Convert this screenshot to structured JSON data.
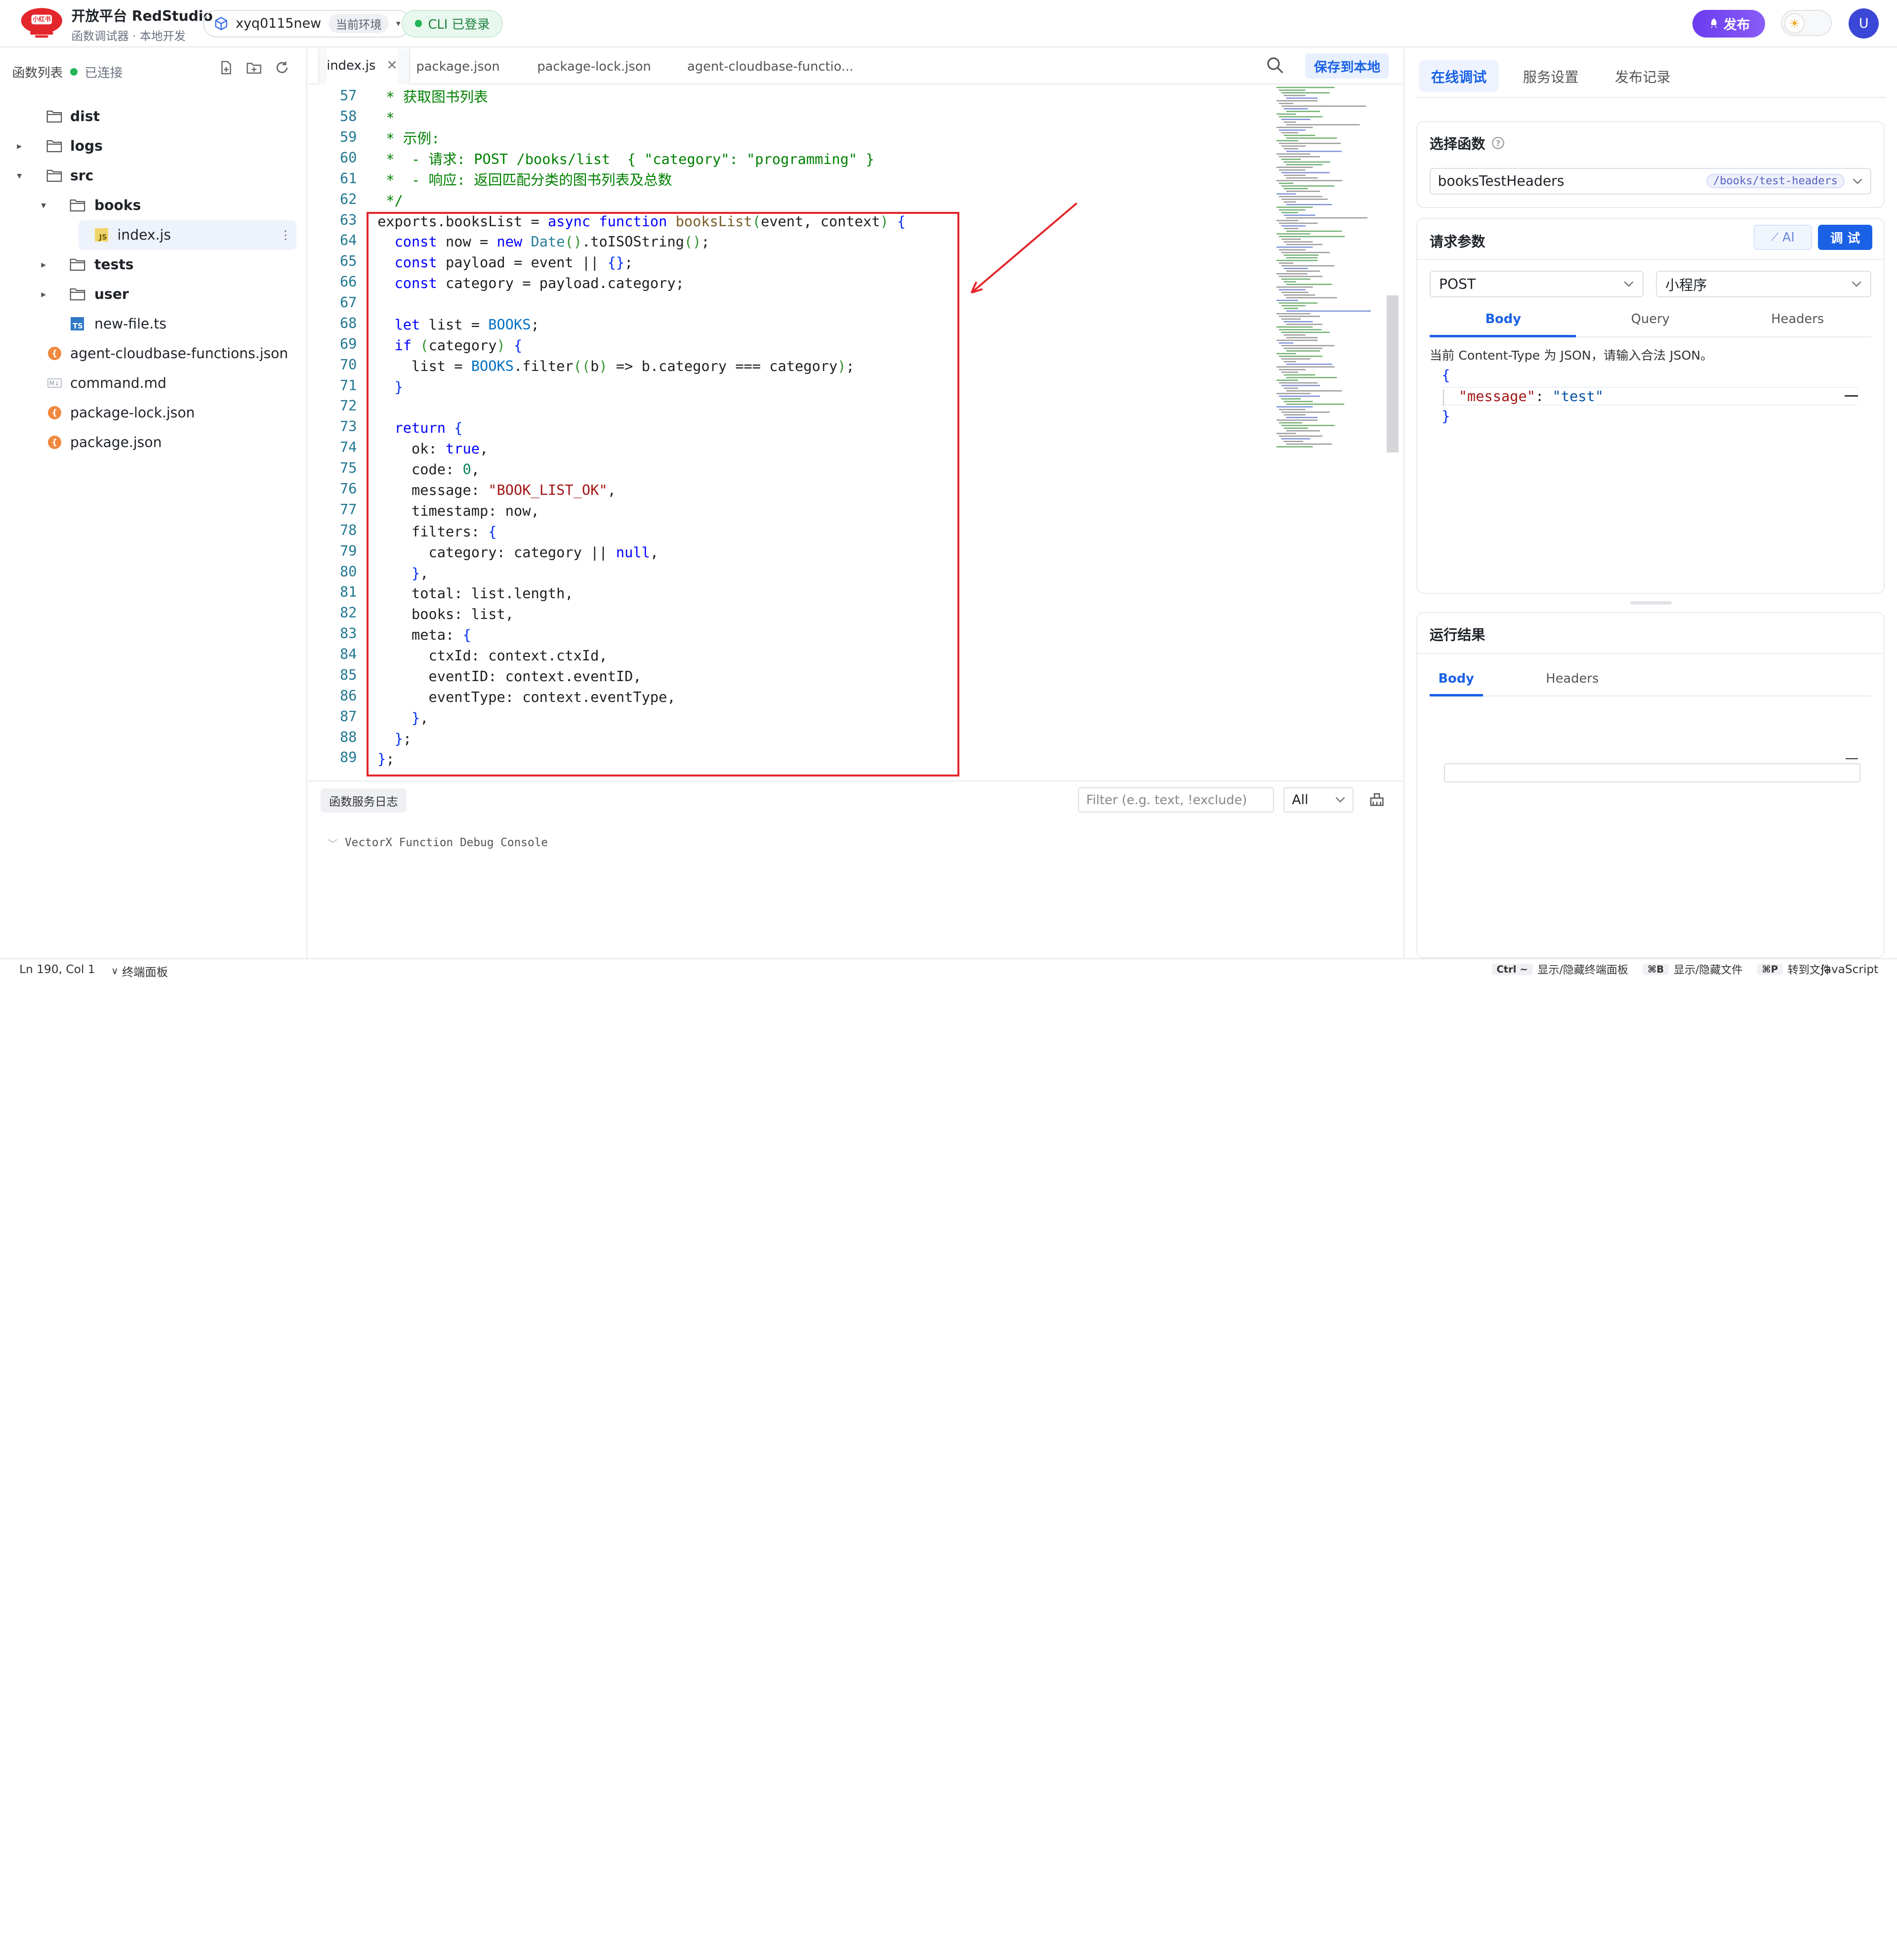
{
  "header": {
    "brand_title": "开放平台 RedStudio",
    "brand_subtitle": "函数调试器 · 本地开发",
    "logo_text": "小红书",
    "env_name": "xyq0115new",
    "env_tag": "当前环境",
    "cli_status": "CLI 已登录",
    "publish_label": "发布",
    "avatar_letter": "U"
  },
  "sidebar": {
    "title": "函数列表",
    "status": "已连接",
    "tree": [
      {
        "label": "dist",
        "type": "folder",
        "level": 1,
        "expand": "none",
        "bold": true
      },
      {
        "label": "logs",
        "type": "folder",
        "level": 1,
        "expand": "collapsed",
        "bold": true
      },
      {
        "label": "src",
        "type": "folder",
        "level": 1,
        "expand": "expanded",
        "bold": true
      },
      {
        "label": "books",
        "type": "folder",
        "level": 2,
        "expand": "expanded",
        "bold": true
      },
      {
        "label": "index.js",
        "type": "js",
        "level": 3,
        "expand": "none",
        "selected": true
      },
      {
        "label": "tests",
        "type": "folder",
        "level": 2,
        "expand": "collapsed",
        "bold": true
      },
      {
        "label": "user",
        "type": "folder",
        "level": 2,
        "expand": "collapsed",
        "bold": true
      },
      {
        "label": "new-file.ts",
        "type": "ts",
        "level": 2,
        "expand": "none"
      },
      {
        "label": "agent-cloudbase-functions.json",
        "type": "json",
        "level": 1,
        "expand": "none"
      },
      {
        "label": "command.md",
        "type": "md",
        "level": 1,
        "expand": "none"
      },
      {
        "label": "package-lock.json",
        "type": "json",
        "level": 1,
        "expand": "none"
      },
      {
        "label": "package.json",
        "type": "json",
        "level": 1,
        "expand": "none"
      }
    ]
  },
  "editor": {
    "tabs": [
      "index.js",
      "package.json",
      "package-lock.json",
      "agent-cloudbase-functio..."
    ],
    "save_label": "保存到本地",
    "line_numbers": [
      "57",
      "58",
      "59",
      "60",
      "61",
      "62",
      "63",
      "64",
      "65",
      "66",
      "67",
      "68",
      "69",
      "70",
      "71",
      "72",
      "73",
      "74",
      "75",
      "76",
      "77",
      "78",
      "79",
      "80",
      "81",
      "82",
      "83",
      "84",
      "85",
      "86",
      "87",
      "88",
      "89"
    ],
    "code_lines": [
      " * 获取图书列表",
      " *",
      " * 示例:",
      " *  - 请求: POST /books/list  { \"category\": \"programming\" }",
      " *  - 响应: 返回匹配分类的图书列表及总数",
      " */",
      "exports.booksList = async function booksList(event, context) {",
      "  const now = new Date().toISOString();",
      "  const payload = event || {};",
      "  const category = payload.category;",
      "",
      "  let list = BOOKS;",
      "  if (category) {",
      "    list = BOOKS.filter((b) => b.category === category);",
      "  }",
      "",
      "  return {",
      "    ok: true,",
      "    code: 0,",
      "    message: \"BOOK_LIST_OK\",",
      "    timestamp: now,",
      "    filters: {",
      "      category: category || null,",
      "    },",
      "    total: list.length,",
      "    books: list,",
      "    meta: {",
      "      ctxId: context.ctxId,",
      "      eventID: context.eventID,",
      "      eventType: context.eventType,",
      "    },",
      "  };",
      "};"
    ]
  },
  "console": {
    "log_button": "函数服务日志",
    "filter_placeholder": "Filter (e.g. text, !exclude)",
    "level": "All",
    "line": "VectorX Function Debug Console"
  },
  "right_panel": {
    "tabs": [
      "在线调试",
      "服务设置",
      "发布记录"
    ],
    "select_fn_title": "选择函数",
    "fn_name": "booksTestHeaders",
    "fn_route": "/books/test-headers",
    "params_title": "请求参数",
    "ai_label": "AI",
    "run_label": "调 试",
    "method": "POST",
    "client": "小程序",
    "param_tabs": [
      "Body",
      "Query",
      "Headers"
    ],
    "content_hint": "当前 Content-Type 为 JSON，请输入合法 JSON。",
    "json_lines": [
      "{",
      "  \"message\": \"test\"",
      "}"
    ],
    "result_title": "运行结果",
    "result_tabs": [
      "Body",
      "Headers"
    ]
  },
  "statusbar": {
    "cursor": "Ln 190, Col 1",
    "terminal_toggle": "终端面板",
    "shortcuts": [
      {
        "key": "Ctrl ~",
        "label": "显示/隐藏终端面板"
      },
      {
        "key": "⌘B",
        "label": "显示/隐藏文件"
      },
      {
        "key": "⌘P",
        "label": "转到文件"
      }
    ],
    "language": "JavaScript"
  },
  "colors": {
    "accent": "#1a61e6",
    "publish": "#7c4cf4",
    "highlight_box": "#e3262b",
    "connected": "#22b457"
  }
}
